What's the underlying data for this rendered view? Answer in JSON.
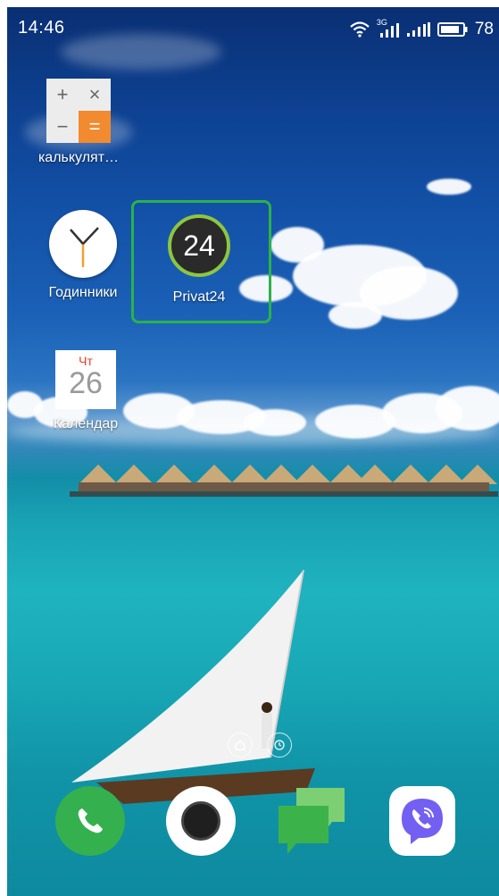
{
  "status_bar": {
    "time": "14:46",
    "network": "3G",
    "battery_percent": "78",
    "icons": [
      "wifi-icon",
      "signal-3g-icon",
      "signal-icon",
      "battery-icon"
    ]
  },
  "desktop": {
    "apps": [
      {
        "name": "calculator",
        "label": "калькулят…",
        "icon": "calculator-icon",
        "glyphs": [
          "+",
          "×",
          "−",
          "="
        ]
      },
      {
        "name": "clock",
        "label": "Годинники",
        "icon": "clock-icon"
      },
      {
        "name": "privat24",
        "label": "Privat24",
        "icon": "privat24-icon",
        "icon_text": "24",
        "highlighted": true,
        "highlight_color": "#2bb24a"
      },
      {
        "name": "calendar",
        "label": "Календар",
        "icon": "calendar-icon",
        "weekday": "Чт",
        "day": "26"
      }
    ]
  },
  "navigation": {
    "icons": [
      "home-icon",
      "clock-small-icon"
    ]
  },
  "dock": {
    "apps": [
      {
        "name": "phone",
        "icon": "phone-icon",
        "color": "#34b14e"
      },
      {
        "name": "camera",
        "icon": "camera-icon"
      },
      {
        "name": "messages",
        "icon": "messages-icon",
        "color": "#3cb34a"
      },
      {
        "name": "viber",
        "icon": "viber-icon",
        "color": "#7360f2"
      }
    ]
  }
}
